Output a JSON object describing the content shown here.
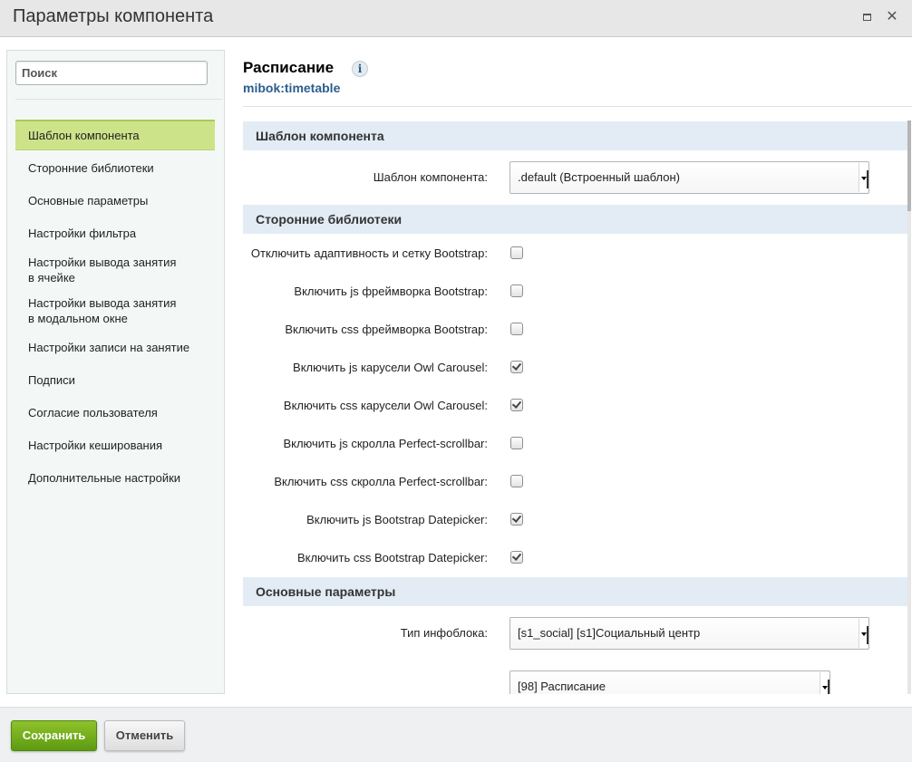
{
  "window": {
    "title": "Параметры компонента"
  },
  "sidebar": {
    "search_placeholder": "Поиск",
    "items": [
      {
        "label": "Шаблон компонента",
        "active": true
      },
      {
        "label": "Сторонние библиотеки"
      },
      {
        "label": "Основные параметры"
      },
      {
        "label": "Настройки фильтра"
      },
      {
        "label": "Настройки вывода занятия в ячейке"
      },
      {
        "label": "Настройки вывода занятия в модальном окне"
      },
      {
        "label": "Настройки записи на занятие"
      },
      {
        "label": "Подписи"
      },
      {
        "label": "Согласие пользователя"
      },
      {
        "label": "Настройки кеширования"
      },
      {
        "label": "Дополнительные настройки"
      }
    ]
  },
  "component": {
    "name": "Расписание",
    "code": "mibok:timetable",
    "info_icon": "info-icon"
  },
  "sections": {
    "template": {
      "title": "Шаблон компонента",
      "template_label": "Шаблон компонента:",
      "template_value": ".default (Встроенный шаблон)"
    },
    "libraries": {
      "title": "Сторонние библиотеки",
      "options": [
        {
          "label": "Отключить адаптивность и сетку Bootstrap:",
          "checked": false
        },
        {
          "label": "Включить js фреймворка Bootstrap:",
          "checked": false
        },
        {
          "label": "Включить css фреймворка Bootstrap:",
          "checked": false
        },
        {
          "label": "Включить js карусели Owl Carousel:",
          "checked": true
        },
        {
          "label": "Включить css карусели Owl Carousel:",
          "checked": true
        },
        {
          "label": "Включить js скролла Perfect-scrollbar:",
          "checked": false
        },
        {
          "label": "Включить css скролла Perfect-scrollbar:",
          "checked": false
        },
        {
          "label": "Включить js Bootstrap Datepicker:",
          "checked": true
        },
        {
          "label": "Включить css Bootstrap Datepicker:",
          "checked": true
        }
      ]
    },
    "main": {
      "title": "Основные параметры",
      "iblock_type_label": "Тип инфоблока:",
      "iblock_type_value": "[s1_social] [s1]Социальный центр",
      "iblock_value": "[98] Расписание"
    }
  },
  "footer": {
    "save_label": "Сохранить",
    "cancel_label": "Отменить"
  },
  "colors": {
    "active_item": "#cde38a",
    "section_header": "#e3ecf5",
    "save_button": "#6fae1c",
    "link": "#2a5d8f"
  }
}
